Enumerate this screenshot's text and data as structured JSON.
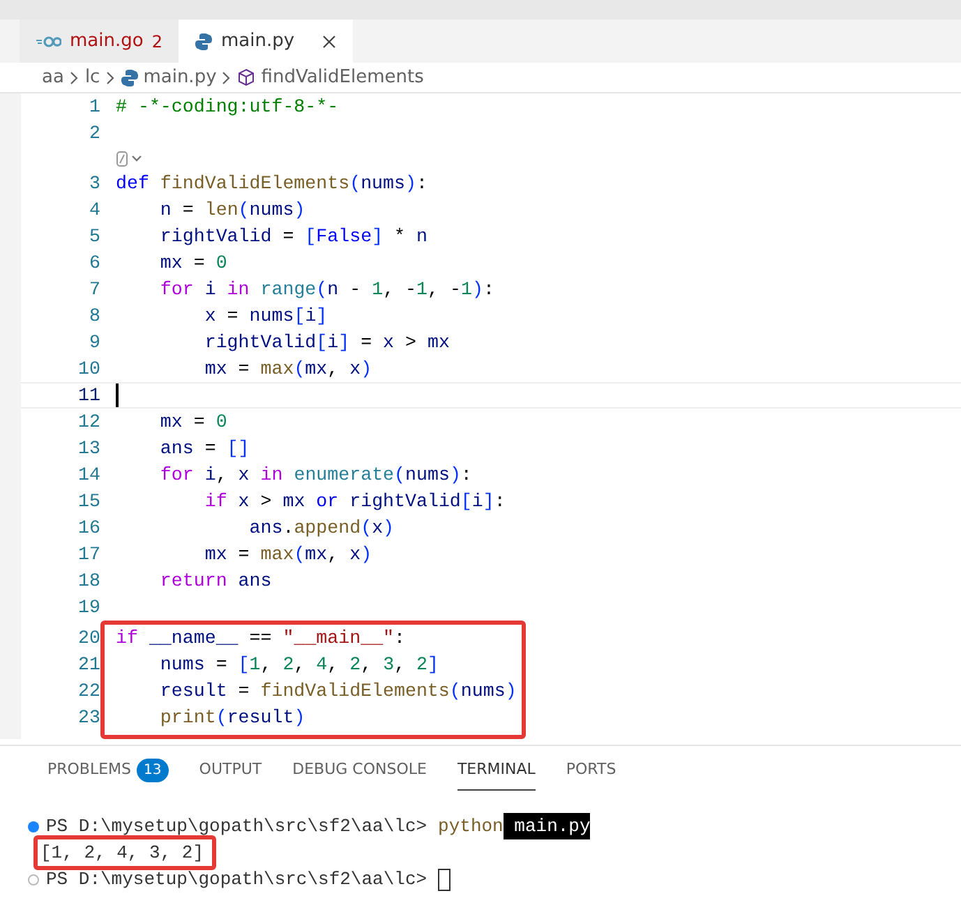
{
  "tabs": [
    {
      "label": "main.go",
      "kind": "go",
      "problem_count": "2",
      "has_errors": true,
      "selected": false
    },
    {
      "label": "main.py",
      "kind": "python",
      "selected": true
    }
  ],
  "breadcrumb": [
    {
      "kind": "folder",
      "text": "aa"
    },
    {
      "kind": "folder",
      "text": "lc"
    },
    {
      "kind": "file",
      "text": "main.py"
    },
    {
      "kind": "symbol",
      "text": "findValidElements"
    }
  ],
  "editor": {
    "lines": [
      {
        "kind": "code",
        "number": "1",
        "current": false,
        "boxed": false,
        "tokens": [
          {
            "kind": "comment",
            "text": "# -*-coding:utf-8-*-"
          }
        ]
      },
      {
        "kind": "code",
        "number": "2",
        "current": false,
        "boxed": false
      },
      {
        "kind": "codelens"
      },
      {
        "kind": "code",
        "number": "3",
        "current": false,
        "boxed": false,
        "tokens": [
          {
            "kind": "keyword",
            "text": "def"
          },
          {
            "kind": "func",
            "text": " findValidElements"
          },
          {
            "kind": "bracket",
            "text": "("
          },
          {
            "kind": "var",
            "text": "nums"
          },
          {
            "kind": "bracket",
            "text": ")"
          },
          {
            "kind": "plain",
            "text": ":"
          }
        ]
      },
      {
        "kind": "code",
        "number": "4",
        "current": false,
        "boxed": false,
        "tokens": [
          {
            "kind": "var",
            "text": "    n"
          },
          {
            "kind": "plain",
            "text": " ="
          },
          {
            "kind": "func",
            "text": " len"
          },
          {
            "kind": "bracket",
            "text": "("
          },
          {
            "kind": "var",
            "text": "nums"
          },
          {
            "kind": "bracket",
            "text": ")"
          }
        ]
      },
      {
        "kind": "code",
        "number": "5",
        "current": false,
        "boxed": false,
        "tokens": [
          {
            "kind": "var",
            "text": "    rightValid"
          },
          {
            "kind": "plain",
            "text": " ="
          },
          {
            "kind": "bracket",
            "text": " ["
          },
          {
            "kind": "keyword",
            "text": "False"
          },
          {
            "kind": "bracket",
            "text": "]"
          },
          {
            "kind": "plain",
            "text": " *"
          },
          {
            "kind": "var",
            "text": " n"
          }
        ]
      },
      {
        "kind": "code",
        "number": "6",
        "current": false,
        "boxed": false,
        "tokens": [
          {
            "kind": "var",
            "text": "    mx"
          },
          {
            "kind": "plain",
            "text": " ="
          },
          {
            "kind": "num",
            "text": " 0"
          }
        ]
      },
      {
        "kind": "code",
        "number": "7",
        "current": false,
        "boxed": false,
        "tokens": [
          {
            "kind": "control",
            "text": "    for"
          },
          {
            "kind": "var",
            "text": " i"
          },
          {
            "kind": "control",
            "text": " in"
          },
          {
            "kind": "builtin",
            "text": " range"
          },
          {
            "kind": "bracket",
            "text": "("
          },
          {
            "kind": "var",
            "text": "n"
          },
          {
            "kind": "plain",
            "text": " -"
          },
          {
            "kind": "num",
            "text": " 1"
          },
          {
            "kind": "plain",
            "text": ", -"
          },
          {
            "kind": "num",
            "text": "1"
          },
          {
            "kind": "plain",
            "text": ", -"
          },
          {
            "kind": "num",
            "text": "1"
          },
          {
            "kind": "bracket",
            "text": ")"
          },
          {
            "kind": "plain",
            "text": ":"
          }
        ]
      },
      {
        "kind": "code",
        "number": "8",
        "current": false,
        "boxed": false,
        "tokens": [
          {
            "kind": "var",
            "text": "        x"
          },
          {
            "kind": "plain",
            "text": " ="
          },
          {
            "kind": "var",
            "text": " nums"
          },
          {
            "kind": "bracket",
            "text": "["
          },
          {
            "kind": "var",
            "text": "i"
          },
          {
            "kind": "bracket",
            "text": "]"
          }
        ]
      },
      {
        "kind": "code",
        "number": "9",
        "current": false,
        "boxed": false,
        "tokens": [
          {
            "kind": "var",
            "text": "        rightValid"
          },
          {
            "kind": "bracket",
            "text": "["
          },
          {
            "kind": "var",
            "text": "i"
          },
          {
            "kind": "bracket",
            "text": "]"
          },
          {
            "kind": "plain",
            "text": " ="
          },
          {
            "kind": "var",
            "text": " x"
          },
          {
            "kind": "plain",
            "text": " >"
          },
          {
            "kind": "var",
            "text": " mx"
          }
        ]
      },
      {
        "kind": "code",
        "number": "10",
        "current": false,
        "boxed": false,
        "tokens": [
          {
            "kind": "var",
            "text": "        mx"
          },
          {
            "kind": "plain",
            "text": " ="
          },
          {
            "kind": "func",
            "text": " max"
          },
          {
            "kind": "bracket",
            "text": "("
          },
          {
            "kind": "var",
            "text": "mx"
          },
          {
            "kind": "plain",
            "text": ","
          },
          {
            "kind": "var",
            "text": " x"
          },
          {
            "kind": "bracket",
            "text": ")"
          }
        ]
      },
      {
        "kind": "code",
        "number": "11",
        "current": true,
        "boxed": false
      },
      {
        "kind": "code",
        "number": "12",
        "current": false,
        "boxed": false,
        "tokens": [
          {
            "kind": "var",
            "text": "    mx"
          },
          {
            "kind": "plain",
            "text": " ="
          },
          {
            "kind": "num",
            "text": " 0"
          }
        ]
      },
      {
        "kind": "code",
        "number": "13",
        "current": false,
        "boxed": false,
        "tokens": [
          {
            "kind": "var",
            "text": "    ans"
          },
          {
            "kind": "plain",
            "text": " ="
          },
          {
            "kind": "bracket",
            "text": " []"
          }
        ]
      },
      {
        "kind": "code",
        "number": "14",
        "current": false,
        "boxed": false,
        "tokens": [
          {
            "kind": "control",
            "text": "    for"
          },
          {
            "kind": "var",
            "text": " i"
          },
          {
            "kind": "plain",
            "text": ","
          },
          {
            "kind": "var",
            "text": " x"
          },
          {
            "kind": "control",
            "text": " in"
          },
          {
            "kind": "builtin",
            "text": " enumerate"
          },
          {
            "kind": "bracket",
            "text": "("
          },
          {
            "kind": "var",
            "text": "nums"
          },
          {
            "kind": "bracket",
            "text": ")"
          },
          {
            "kind": "plain",
            "text": ":"
          }
        ]
      },
      {
        "kind": "code",
        "number": "15",
        "current": false,
        "boxed": false,
        "tokens": [
          {
            "kind": "control",
            "text": "        if"
          },
          {
            "kind": "var",
            "text": " x"
          },
          {
            "kind": "plain",
            "text": " >"
          },
          {
            "kind": "var",
            "text": " mx"
          },
          {
            "kind": "keyword",
            "text": " or"
          },
          {
            "kind": "var",
            "text": " rightValid"
          },
          {
            "kind": "bracket",
            "text": "["
          },
          {
            "kind": "var",
            "text": "i"
          },
          {
            "kind": "bracket",
            "text": "]"
          },
          {
            "kind": "plain",
            "text": ":"
          }
        ]
      },
      {
        "kind": "code",
        "number": "16",
        "current": false,
        "boxed": false,
        "tokens": [
          {
            "kind": "var",
            "text": "            ans"
          },
          {
            "kind": "plain",
            "text": "."
          },
          {
            "kind": "func",
            "text": "append"
          },
          {
            "kind": "bracket",
            "text": "("
          },
          {
            "kind": "var",
            "text": "x"
          },
          {
            "kind": "bracket",
            "text": ")"
          }
        ]
      },
      {
        "kind": "code",
        "number": "17",
        "current": false,
        "boxed": false,
        "tokens": [
          {
            "kind": "var",
            "text": "        mx"
          },
          {
            "kind": "plain",
            "text": " ="
          },
          {
            "kind": "func",
            "text": " max"
          },
          {
            "kind": "bracket",
            "text": "("
          },
          {
            "kind": "var",
            "text": "mx"
          },
          {
            "kind": "plain",
            "text": ","
          },
          {
            "kind": "var",
            "text": " x"
          },
          {
            "kind": "bracket",
            "text": ")"
          }
        ]
      },
      {
        "kind": "code",
        "number": "18",
        "current": false,
        "boxed": false,
        "tokens": [
          {
            "kind": "control",
            "text": "    return"
          },
          {
            "kind": "var",
            "text": " ans"
          }
        ]
      },
      {
        "kind": "code",
        "number": "19",
        "current": false,
        "boxed": false
      },
      {
        "kind": "code",
        "number": "20",
        "current": false,
        "boxed": true,
        "tokens": [
          {
            "kind": "control",
            "text": "if"
          },
          {
            "kind": "var",
            "text": " __name__"
          },
          {
            "kind": "plain",
            "text": " =="
          },
          {
            "kind": "str",
            "text": " \"__main__\""
          },
          {
            "kind": "plain",
            "text": ":"
          }
        ]
      },
      {
        "kind": "code",
        "number": "21",
        "current": false,
        "boxed": true,
        "tokens": [
          {
            "kind": "var",
            "text": "    nums"
          },
          {
            "kind": "plain",
            "text": " ="
          },
          {
            "kind": "bracket",
            "text": " ["
          },
          {
            "kind": "num",
            "text": "1"
          },
          {
            "kind": "plain",
            "text": ","
          },
          {
            "kind": "num",
            "text": " 2"
          },
          {
            "kind": "plain",
            "text": ","
          },
          {
            "kind": "num",
            "text": " 4"
          },
          {
            "kind": "plain",
            "text": ","
          },
          {
            "kind": "num",
            "text": " 2"
          },
          {
            "kind": "plain",
            "text": ","
          },
          {
            "kind": "num",
            "text": " 3"
          },
          {
            "kind": "plain",
            "text": ","
          },
          {
            "kind": "num",
            "text": " 2"
          },
          {
            "kind": "bracket",
            "text": "]"
          }
        ]
      },
      {
        "kind": "code",
        "number": "22",
        "current": false,
        "boxed": true,
        "tokens": [
          {
            "kind": "var",
            "text": "    result"
          },
          {
            "kind": "plain",
            "text": " ="
          },
          {
            "kind": "func",
            "text": " findValidElements"
          },
          {
            "kind": "bracket",
            "text": "("
          },
          {
            "kind": "var",
            "text": "nums"
          },
          {
            "kind": "bracket",
            "text": ")"
          }
        ]
      },
      {
        "kind": "code",
        "number": "23",
        "current": false,
        "boxed": true,
        "tokens": [
          {
            "kind": "func",
            "text": "    print"
          },
          {
            "kind": "bracket",
            "text": "("
          },
          {
            "kind": "var",
            "text": "result"
          },
          {
            "kind": "bracket",
            "text": ")"
          }
        ]
      }
    ]
  },
  "panel": {
    "tabs": [
      {
        "label": "PROBLEMS",
        "badge": "13",
        "selected": false
      },
      {
        "label": "OUTPUT",
        "selected": false
      },
      {
        "label": "DEBUG CONSOLE",
        "selected": false
      },
      {
        "label": "TERMINAL",
        "selected": true
      },
      {
        "label": "PORTS",
        "selected": false
      }
    ],
    "terminal": [
      {
        "kind": "command",
        "succeeded": true,
        "prompt": "PS D:\\mysetup\\gopath\\src\\sf2\\aa\\lc>",
        "command": "python",
        "argument": "main.py",
        "argument_selected": true
      },
      {
        "kind": "output",
        "text": "[1, 2, 4, 3, 2]",
        "boxed": true
      },
      {
        "kind": "command",
        "succeeded": false,
        "prompt": "PS D:\\mysetup\\gopath\\src\\sf2\\aa\\lc>",
        "cursor": true
      }
    ]
  }
}
